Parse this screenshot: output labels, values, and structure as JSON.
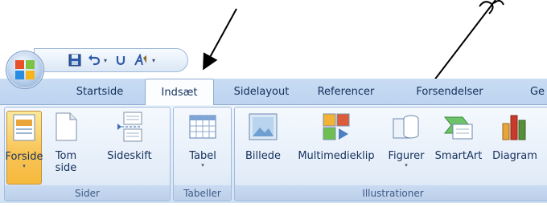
{
  "quick_access": {
    "undo_dropdown": "▾"
  },
  "tabs": [
    {
      "label": "Startside"
    },
    {
      "label": "Indsæt",
      "active": true
    },
    {
      "label": "Sidelayout"
    },
    {
      "label": "Referencer"
    },
    {
      "label": "Forsendelser"
    },
    {
      "label": "Ge"
    }
  ],
  "groups": {
    "sider": {
      "label": "Sider",
      "buttons": [
        {
          "label": "Forside",
          "icon": "cover-page-icon",
          "dropdown": "▾"
        },
        {
          "label": "Tom side",
          "icon": "blank-page-icon"
        },
        {
          "label": "Sideskift",
          "icon": "page-break-icon"
        }
      ]
    },
    "tabeller": {
      "label": "Tabeller",
      "buttons": [
        {
          "label": "Tabel",
          "icon": "table-icon",
          "dropdown": "▾"
        }
      ]
    },
    "illustrationer": {
      "label": "Illustrationer",
      "buttons": [
        {
          "label": "Billede",
          "icon": "picture-icon"
        },
        {
          "label": "Multimedieklip",
          "icon": "clip-art-icon"
        },
        {
          "label": "Figurer",
          "icon": "shapes-icon",
          "dropdown": "▾"
        },
        {
          "label": "SmartArt",
          "icon": "smartart-icon"
        },
        {
          "label": "Diagram",
          "icon": "chart-icon"
        }
      ]
    }
  },
  "colors": {
    "ribbon_bg": "#dde9f7",
    "tab_text": "#15305b",
    "group_label_text": "#3e5a84",
    "pressed_button": "#f8c558"
  }
}
